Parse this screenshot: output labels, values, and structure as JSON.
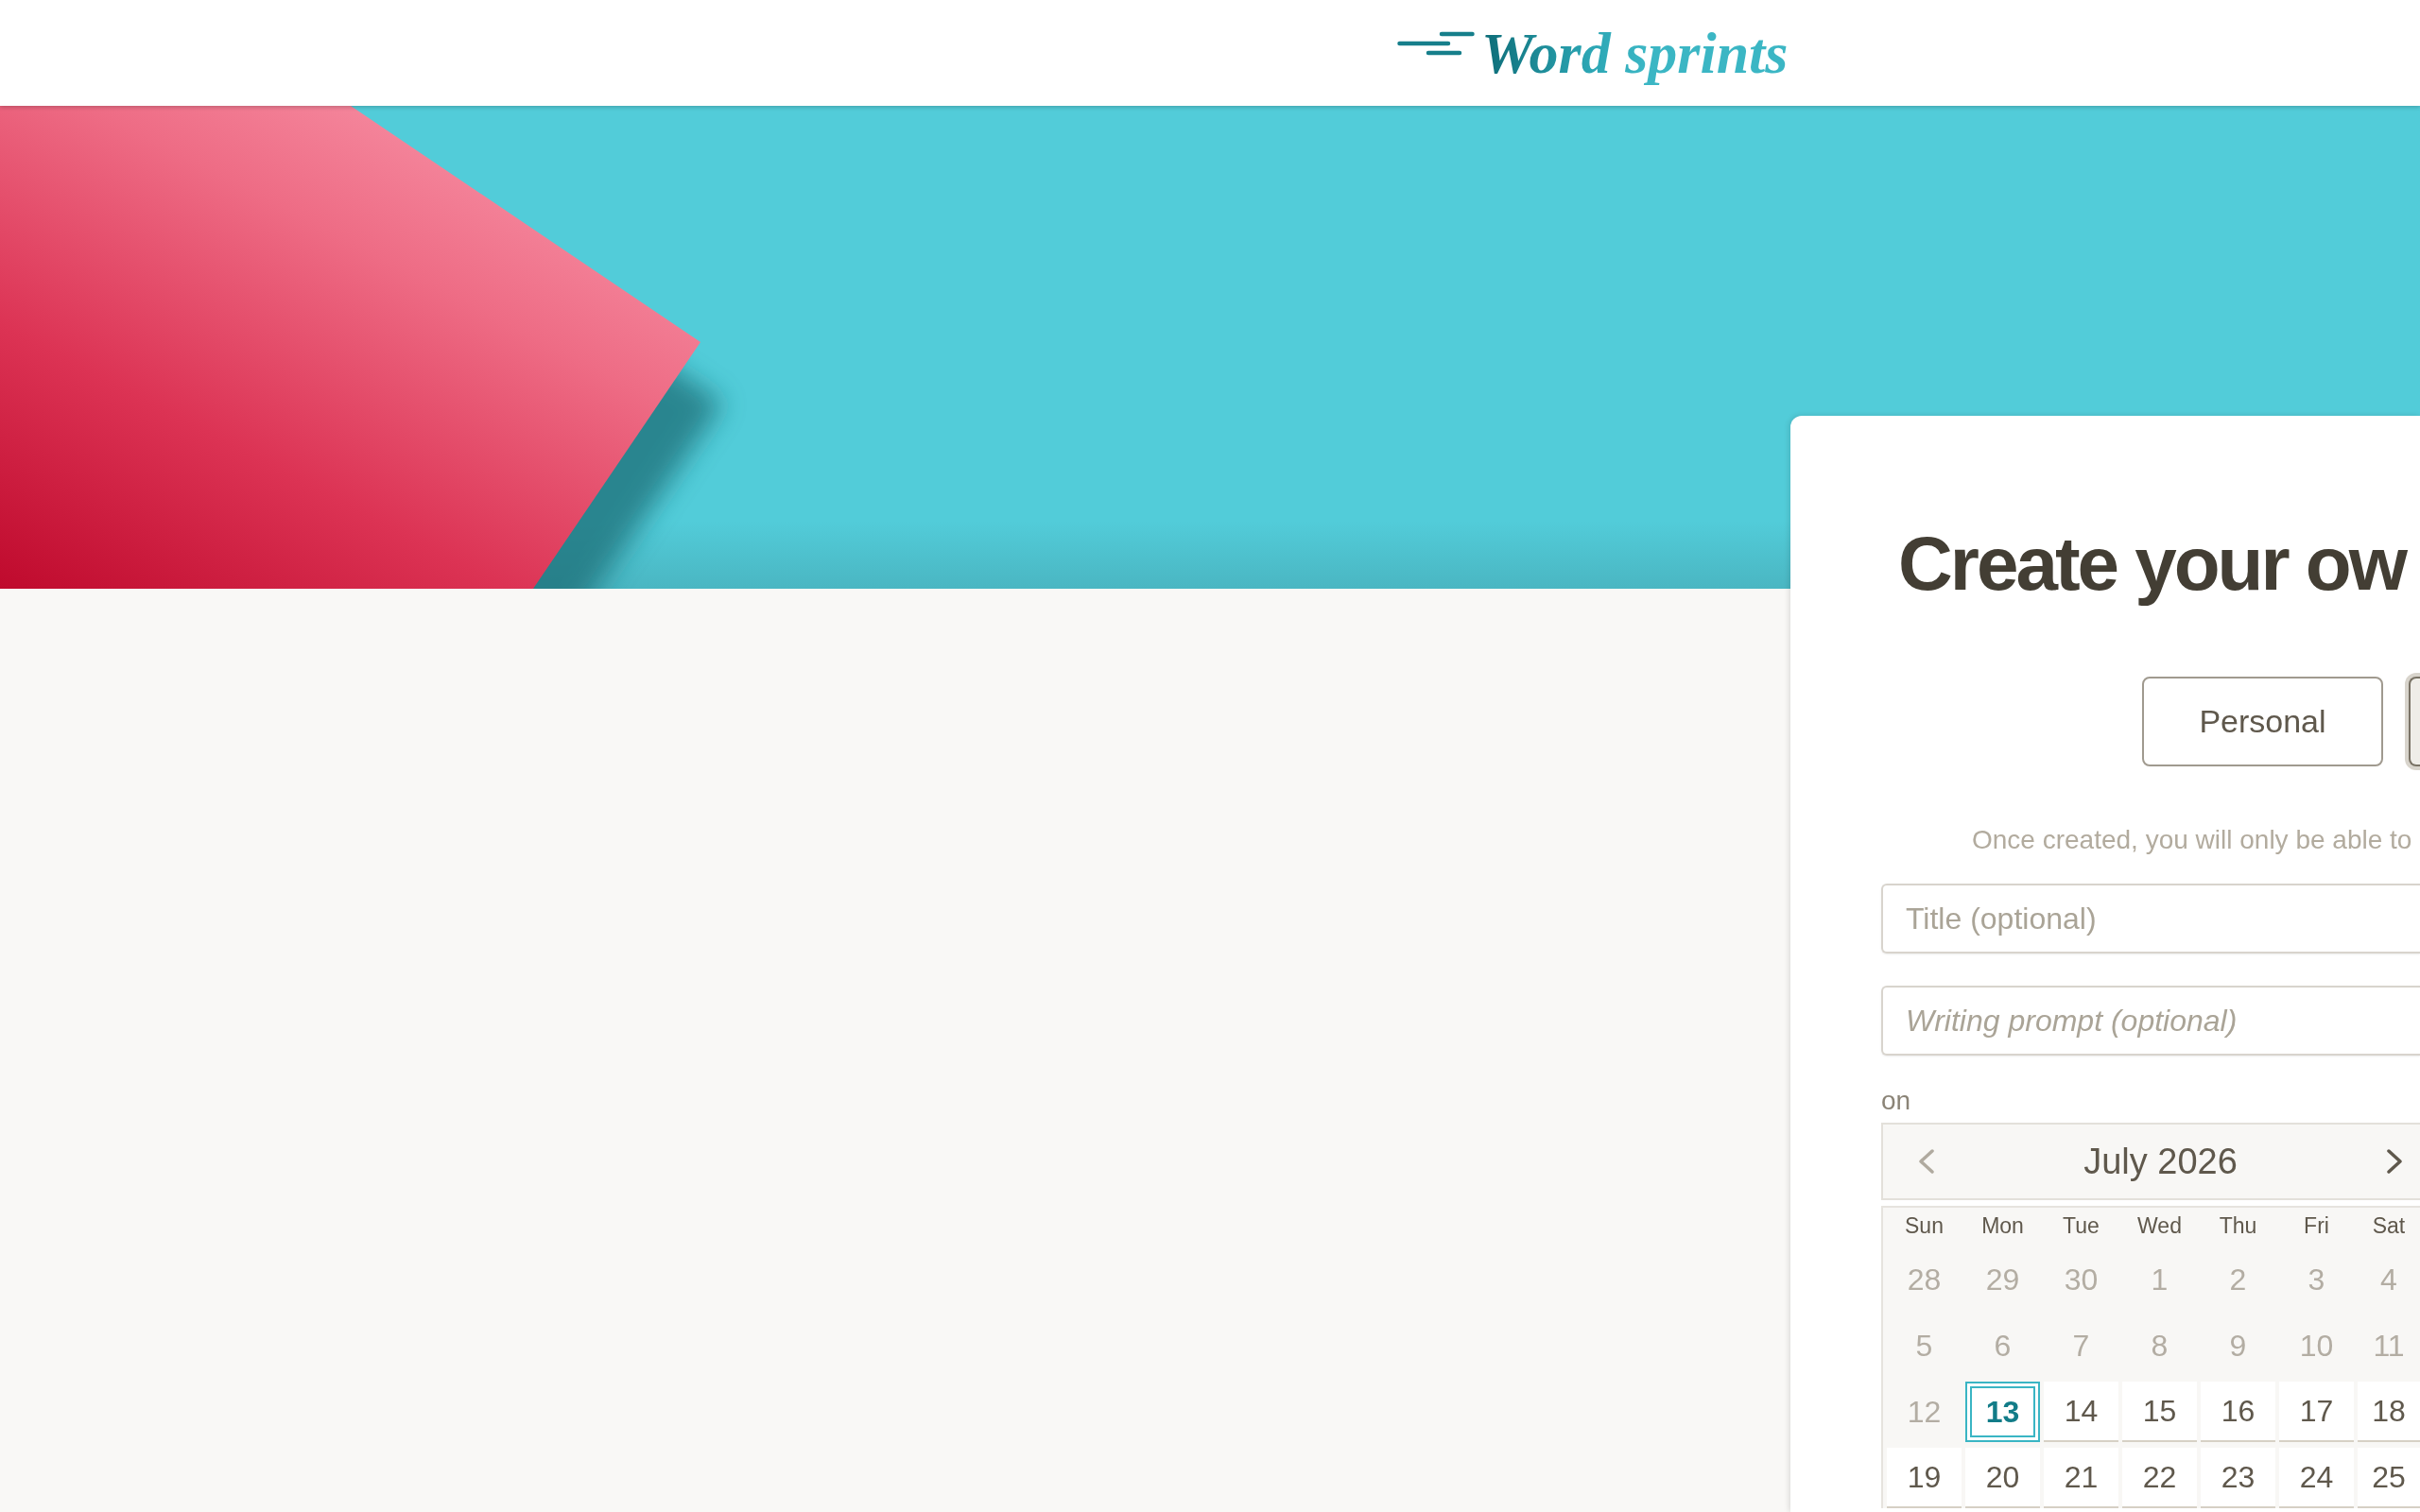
{
  "header": {
    "logo": "Word sprints"
  },
  "card": {
    "title": "Create your ow",
    "modes": [
      {
        "label": "Personal",
        "selected": false
      },
      {
        "selected": true
      }
    ],
    "notice": "Once created, you will only be able to",
    "fields": [
      {
        "kind": "title",
        "placeholder": "Title (optional)"
      },
      {
        "kind": "prompt",
        "placeholder": "Writing prompt (optional)"
      }
    ],
    "date_label": "on",
    "calendar": {
      "month": "July 2026",
      "prev": {
        "disabled": true
      },
      "next": {
        "disabled": false
      },
      "weekdays": [
        "Sun",
        "Mon",
        "Tue",
        "Wed",
        "Thu",
        "Fri",
        "Sat"
      ],
      "weeks": [
        [
          {
            "day": "28",
            "disabled": true,
            "selected": false
          },
          {
            "day": "29",
            "disabled": true,
            "selected": false
          },
          {
            "day": "30",
            "disabled": true,
            "selected": false
          },
          {
            "day": "1",
            "disabled": true,
            "selected": false
          },
          {
            "day": "2",
            "disabled": true,
            "selected": false
          },
          {
            "day": "3",
            "disabled": true,
            "selected": false
          },
          {
            "day": "4",
            "disabled": true,
            "selected": false
          }
        ],
        [
          {
            "day": "5",
            "disabled": true,
            "selected": false
          },
          {
            "day": "6",
            "disabled": true,
            "selected": false
          },
          {
            "day": "7",
            "disabled": true,
            "selected": false
          },
          {
            "day": "8",
            "disabled": true,
            "selected": false
          },
          {
            "day": "9",
            "disabled": true,
            "selected": false
          },
          {
            "day": "10",
            "disabled": true,
            "selected": false
          },
          {
            "day": "11",
            "disabled": true,
            "selected": false
          }
        ],
        [
          {
            "day": "12",
            "disabled": true,
            "selected": false
          },
          {
            "day": "13",
            "disabled": false,
            "selected": true
          },
          {
            "day": "14",
            "disabled": false,
            "selected": false
          },
          {
            "day": "15",
            "disabled": false,
            "selected": false
          },
          {
            "day": "16",
            "disabled": false,
            "selected": false
          },
          {
            "day": "17",
            "disabled": false,
            "selected": false
          },
          {
            "day": "18",
            "disabled": false,
            "selected": false
          }
        ],
        [
          {
            "day": "19",
            "disabled": false,
            "selected": false
          },
          {
            "day": "20",
            "disabled": false,
            "selected": false
          },
          {
            "day": "21",
            "disabled": false,
            "selected": false
          },
          {
            "day": "22",
            "disabled": false,
            "selected": false
          },
          {
            "day": "23",
            "disabled": false,
            "selected": false
          },
          {
            "day": "24",
            "disabled": false,
            "selected": false
          },
          {
            "day": "25",
            "disabled": false,
            "selected": false
          }
        ]
      ]
    }
  }
}
